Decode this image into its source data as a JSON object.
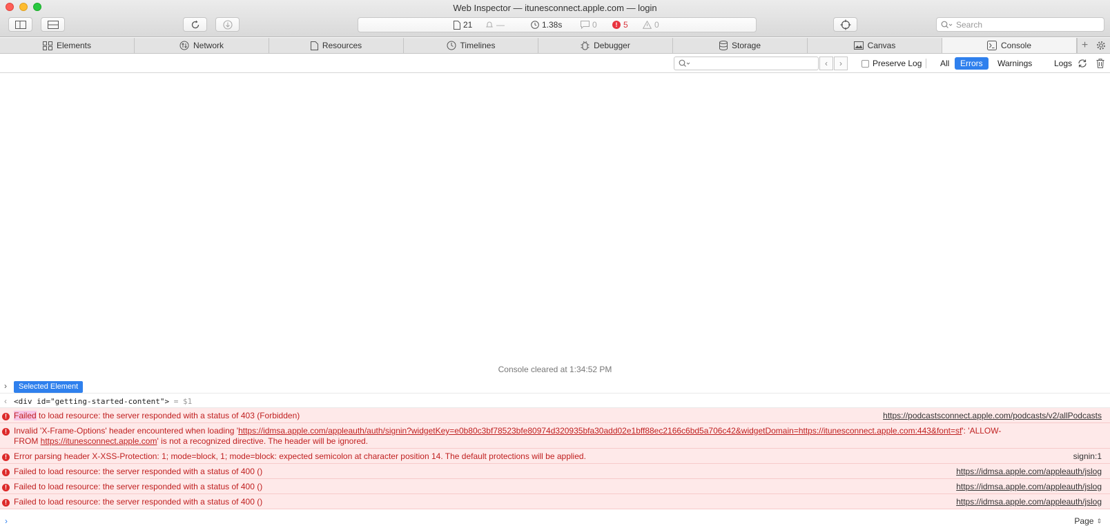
{
  "window": {
    "title": "Web Inspector — itunesconnect.apple.com — login"
  },
  "toolbar": {
    "resource_count": "21",
    "load_dash": "—",
    "load_time": "1.38s",
    "log_count": "0",
    "error_count": "5",
    "warning_count": "0",
    "search_placeholder": "Search"
  },
  "tabs": [
    {
      "label": "Elements",
      "icon": "elements-icon"
    },
    {
      "label": "Network",
      "icon": "network-icon"
    },
    {
      "label": "Resources",
      "icon": "resources-icon"
    },
    {
      "label": "Timelines",
      "icon": "timelines-icon"
    },
    {
      "label": "Debugger",
      "icon": "debugger-icon"
    },
    {
      "label": "Storage",
      "icon": "storage-icon"
    },
    {
      "label": "Canvas",
      "icon": "canvas-icon"
    },
    {
      "label": "Console",
      "icon": "console-icon",
      "active": true
    }
  ],
  "filter": {
    "search_value": "",
    "preserve_log_label": "Preserve Log",
    "buttons": [
      "All",
      "Errors",
      "Warnings",
      "Logs"
    ],
    "active": "Errors"
  },
  "console": {
    "cleared_text": "Console cleared at 1:34:52 PM",
    "selected_badge": "Selected Element",
    "element_html": "<div id=\"getting-started-content\">",
    "element_var": "= $1",
    "messages": [
      {
        "hl": "Failed",
        "text": " to load resource: the server responded with a status of 403 (Forbidden)",
        "source": "https://podcastsconnect.apple.com/podcasts/v2/allPodcasts"
      },
      {
        "pre": "Invalid 'X-Frame-Options' header encountered when loading '",
        "link1": "https://idmsa.apple.com/appleauth/auth/signin?widgetKey=e0b80c3bf78523bfe80974d320935bfa30add02e1bff88ec2166c6bd5a706c42&widgetDomain=https://itunesconnect.apple.com:443&font=sf",
        "mid": "': 'ALLOW-",
        "line2pre": "FROM ",
        "link2": "https://itunesconnect.apple.com",
        "post": "' is not a recognized directive. The header will be ignored."
      },
      {
        "text": "Error parsing header X-XSS-Protection: 1; mode=block, 1; mode=block: expected semicolon at character position 14. The default protections will be applied.",
        "source": "signin:1"
      },
      {
        "text": "Failed to load resource: the server responded with a status of 400 ()",
        "source": "https://idmsa.apple.com/appleauth/jslog"
      },
      {
        "text": "Failed to load resource: the server responded with a status of 400 ()",
        "source": "https://idmsa.apple.com/appleauth/jslog"
      },
      {
        "text": "Failed to load resource: the server responded with a status of 400 ()",
        "source": "https://idmsa.apple.com/appleauth/jslog"
      }
    ],
    "page_selector": "Page"
  },
  "colors": {
    "accent": "#2f80ed",
    "error": "#dd2a2a",
    "error_bg": "#fee9e9"
  }
}
